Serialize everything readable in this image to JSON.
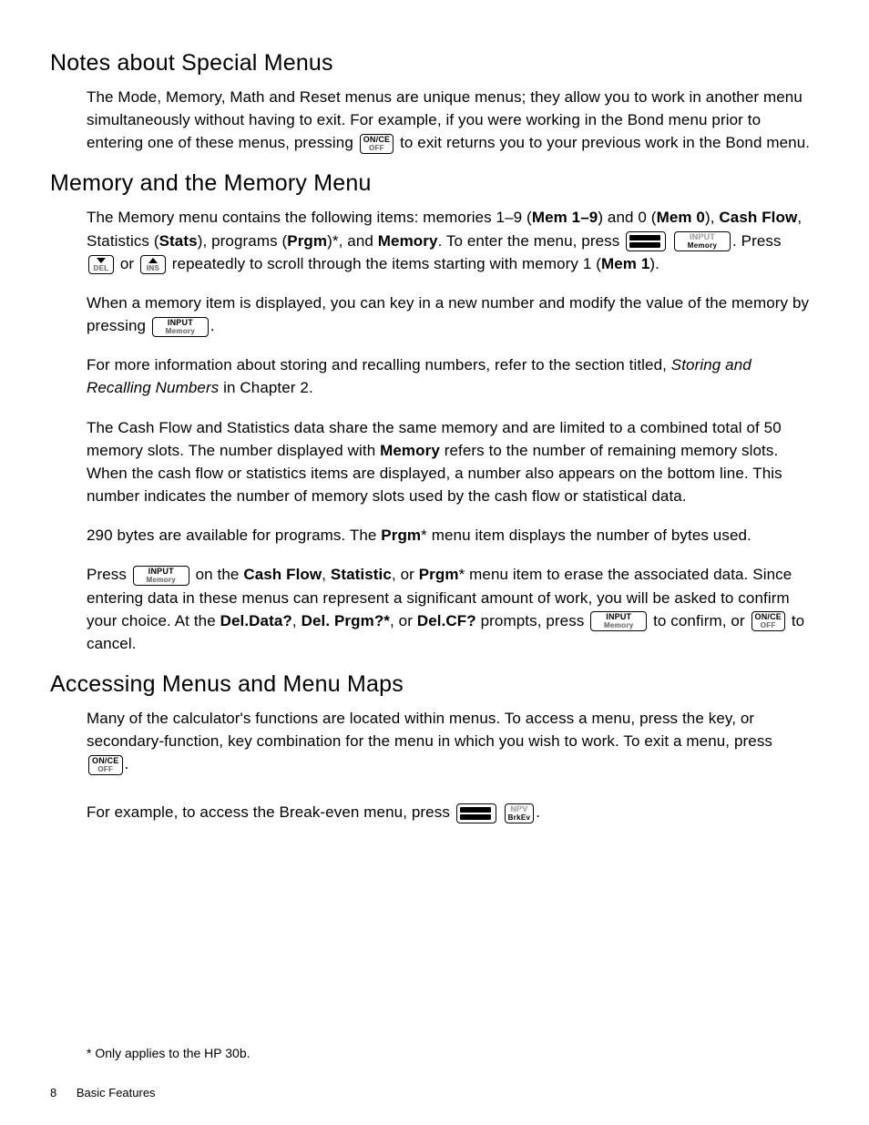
{
  "sections": {
    "s1": {
      "heading": "Notes about Special Menus",
      "p1a": "The Mode, Memory, Math and Reset menus are unique menus; they allow you to work in another menu simultaneously without having to exit. For example, if you were working in the Bond menu prior to entering one of these menus, pressing ",
      "p1b": " to exit returns you to your previous work in the Bond menu."
    },
    "s2": {
      "heading": "Memory and the Memory Menu",
      "p1_parts": {
        "a": "The Memory menu contains the following items: memories 1–9 (",
        "b": "Mem 1–9",
        "c": ") and 0 (",
        "d": "Mem 0",
        "e": "), ",
        "f": "Cash Flow",
        "g": ", Statistics (",
        "h": "Stats",
        "i": "), programs (",
        "j": "Prgm",
        "k": ")*, and ",
        "l": "Memory",
        "m": ". To enter the menu, press ",
        "n": ". Press ",
        "o": " or ",
        "p": " repeatedly to scroll through the items starting with memory 1 (",
        "q": "Mem 1",
        "r": ")."
      },
      "p2a": "When a memory item is displayed, you can key in a new number and modify the value of the memory by pressing ",
      "p2b": ".",
      "p3a": "For more information about storing and recalling numbers, refer to the section titled, ",
      "p3i": "Storing and Recalling Numbers",
      "p3b": " in Chapter 2.",
      "p4a": "The Cash Flow and Statistics data share the same memory and are limited to a combined total of 50 memory slots. The number displayed with ",
      "p4b": "Memory",
      "p4c": " refers to the number of remaining memory slots. When the cash flow or statistics items are displayed, a number also appears on the bottom line. This number indicates the number of memory slots used by the cash flow or statistical data.",
      "p5a": "290 bytes are available for programs. The ",
      "p5b": "Prgm",
      "p5c": "* menu item displays the number of bytes used.",
      "p6_parts": {
        "a": "Press ",
        "b": " on the ",
        "c": "Cash Flow",
        "d": ", ",
        "e": "Statistic",
        "f": ", or ",
        "g": "Prgm",
        "h": "* menu item to erase the associated data. Since entering data in these menus can represent a significant amount of work, you will be asked to confirm your choice. At the ",
        "i": "Del.Data?",
        "j": ", ",
        "k": "Del. Prgm?*",
        "l": ", or ",
        "m": "Del.CF?",
        "n": " prompts, press ",
        "o": " to confirm, or ",
        "p": " to cancel."
      }
    },
    "s3": {
      "heading": "Accessing Menus and Menu Maps",
      "p1a": "Many of the calculator's functions are located within menus. To access a menu, press the key, or secondary-function, key combination for the menu in which you wish to work. To exit a menu, press ",
      "p1b": ".",
      "p2a": "For example, to access the Break-even menu, press ",
      "p2b": "."
    }
  },
  "keys": {
    "once_top": "ON/CE",
    "once_bot": "OFF",
    "input_top": "INPUT",
    "input_bot": "Memory",
    "down_bot": "DEL",
    "up_bot": "INS",
    "npv_top": "NPV",
    "npv_bot": "BrkEv"
  },
  "footnote": "* Only applies to the HP 30b.",
  "footer": {
    "page": "8",
    "section": "Basic Features"
  }
}
